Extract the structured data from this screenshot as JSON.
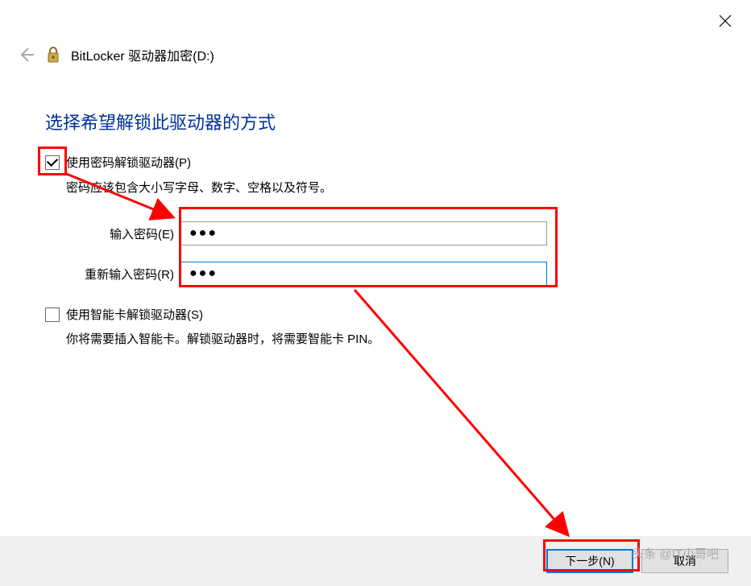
{
  "window": {
    "title": "BitLocker 驱动器加密(D:)"
  },
  "heading": "选择希望解锁此驱动器的方式",
  "password_option": {
    "checked": true,
    "label": "使用密码解锁驱动器(P)",
    "description": "密码应该包含大小写字母、数字、空格以及符号。",
    "enter_label": "输入密码(E)",
    "reenter_label": "重新输入密码(R)",
    "value1": "●●●",
    "value2": "●●●"
  },
  "smartcard_option": {
    "checked": false,
    "label": "使用智能卡解锁驱动器(S)",
    "description": "你将需要插入智能卡。解锁驱动器时，将需要智能卡 PIN。"
  },
  "buttons": {
    "next": "下一步(N)",
    "cancel": "取消"
  },
  "watermark": "头条 @IT小哥吧"
}
